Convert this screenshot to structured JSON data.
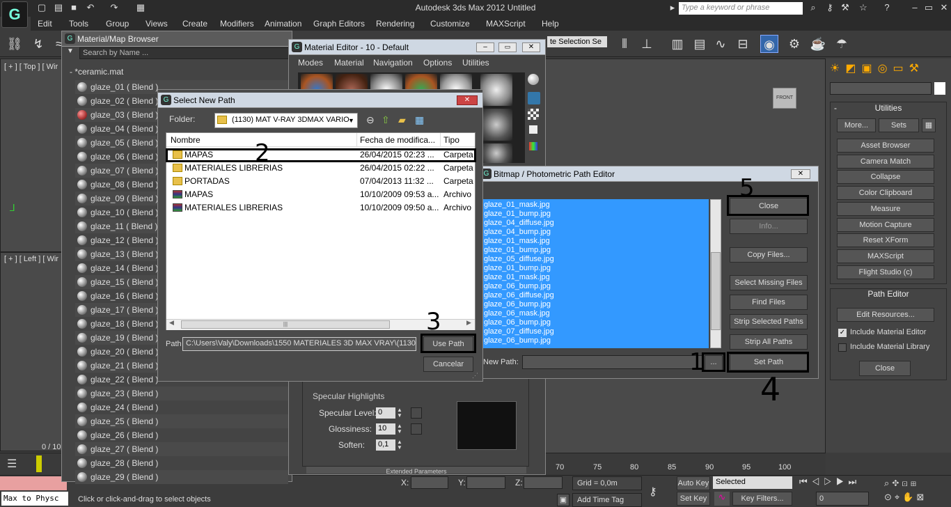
{
  "app": {
    "title": "Autodesk 3ds Max  2012     Untitled",
    "search_placeholder": "Type a keyword or phrase"
  },
  "menu": [
    "Edit",
    "Tools",
    "Group",
    "Views",
    "Create",
    "Modifiers",
    "Animation",
    "Graph Editors",
    "Rendering",
    "Customize",
    "MAXScript",
    "Help"
  ],
  "toolbar": {
    "selection_set": "te Selection Se"
  },
  "viewports": {
    "top_label": "[ + ] [ Top ] [ Wir",
    "left_label": "[ + ] [ Left ] [ Wir",
    "frame_counter": "0 / 10"
  },
  "browser": {
    "title": "Material/Map Browser",
    "search_placeholder": "Search by Name ...",
    "group": "- *ceramic.mat",
    "items": [
      "glaze_01  ( Blend )",
      "glaze_02  ( Blend )",
      "glaze_03  ( Blend )",
      "glaze_04  ( Blend )",
      "glaze_05  ( Blend )",
      "glaze_06  ( Blend )",
      "glaze_07  ( Blend )",
      "glaze_08  ( Blend )",
      "glaze_09  ( Blend )",
      "glaze_10  ( Blend )",
      "glaze_11  ( Blend )",
      "glaze_12  ( Blend )",
      "glaze_13  ( Blend )",
      "glaze_14  ( Blend )",
      "glaze_15  ( Blend )",
      "glaze_16  ( Blend )",
      "glaze_17  ( Blend )",
      "glaze_18  ( Blend )",
      "glaze_19  ( Blend )",
      "glaze_20  ( Blend )",
      "glaze_21  ( Blend )",
      "glaze_22  ( Blend )",
      "glaze_23  ( Blend )",
      "glaze_24  ( Blend )",
      "glaze_25  ( Blend )",
      "glaze_26  ( Blend )",
      "glaze_27  ( Blend )",
      "glaze_28  ( Blend )",
      "glaze_29  ( Blend )"
    ]
  },
  "mat_editor": {
    "title": "Material Editor - 10 - Default",
    "menu": [
      "Modes",
      "Material",
      "Navigation",
      "Options",
      "Utilities"
    ],
    "specular_group": "Specular Highlights",
    "specular_level_label": "Specular Level:",
    "specular_level": "0",
    "glossiness_label": "Glossiness:",
    "glossiness": "10",
    "soften_label": "Soften:",
    "soften": "0,1",
    "extended": "Extended Parameters"
  },
  "select_path": {
    "title": "Select New Path",
    "folder_label": "Folder:",
    "folder_value": "(1130) MAT  V-RAY 3DMAX VARIO",
    "columns": [
      "Nombre",
      "Fecha de modifica...",
      "Tipo"
    ],
    "rows": [
      {
        "name": "MAPAS",
        "date": "26/04/2015 02:23 ...",
        "type": "Carpeta",
        "kind": "folder"
      },
      {
        "name": "MATERIALES LIBRERIAS",
        "date": "26/04/2015 02:22 ...",
        "type": "Carpeta",
        "kind": "folder"
      },
      {
        "name": "PORTADAS",
        "date": "07/04/2013 11:32 ...",
        "type": "Carpeta",
        "kind": "folder"
      },
      {
        "name": "MAPAS",
        "date": "10/10/2009 09:53 a...",
        "type": "Archivo",
        "kind": "archive"
      },
      {
        "name": "MATERIALES LIBRERIAS",
        "date": "10/10/2009 09:50 a...",
        "type": "Archivo",
        "kind": "archive"
      }
    ],
    "path_label": "Path",
    "path_value": "C:\\Users\\Valy\\Downloads\\1550 MATERIALES 3D MAX VRAY\\(1130) M",
    "use_path": "Use Path",
    "cancel": "Cancelar"
  },
  "bitmap_editor": {
    "title": "Bitmap / Photometric Path Editor",
    "files": [
      "glaze_01_mask.jpg",
      "glaze_01_bump.jpg",
      "glaze_04_diffuse.jpg",
      "glaze_04_bump.jpg",
      "glaze_01_mask.jpg",
      "glaze_01_bump.jpg",
      "glaze_05_diffuse.jpg",
      "glaze_01_bump.jpg",
      "glaze_01_mask.jpg",
      "glaze_06_bump.jpg",
      "glaze_06_diffuse.jpg",
      "glaze_06_bump.jpg",
      "glaze_06_mask.jpg",
      "glaze_06_bump.jpg",
      "glaze_07_diffuse.jpg",
      "glaze_06_bump.jpg"
    ],
    "close": "Close",
    "info": "Info...",
    "copy_files": "Copy Files...",
    "select_missing": "Select Missing Files",
    "find_files": "Find Files",
    "strip_selected": "Strip Selected Paths",
    "strip_all": "Strip All Paths",
    "new_path_label": "New Path:",
    "browse": "...",
    "set_path": "Set Path"
  },
  "command_panel": {
    "utilities_title": "Utilities",
    "more": "More...",
    "sets": "Sets",
    "utilities": [
      "Asset Browser",
      "Camera Match",
      "Collapse",
      "Color Clipboard",
      "Measure",
      "Motion Capture",
      "Reset XForm",
      "MAXScript",
      "Flight Studio (c)"
    ],
    "path_editor_title": "Path Editor",
    "edit_resources": "Edit Resources...",
    "include_material_editor": "Include Material Editor",
    "include_material_library": "Include Material Library",
    "close": "Close",
    "viewcube": "FRONT"
  },
  "annotations": [
    "1",
    "2",
    "3",
    "4",
    "5"
  ],
  "statusbar": {
    "script_mini": "Max to Physc",
    "prompt": "Click or click-and-drag to select objects",
    "x_label": "X:",
    "y_label": "Y:",
    "z_label": "Z:",
    "grid": "Grid = 0,0m",
    "auto_key": "Auto Key",
    "selected": "Selected",
    "set_key": "Set Key",
    "key_filters": "Key Filters...",
    "add_time_tag": "Add Time Tag",
    "frame": "0",
    "ruler": [
      "70",
      "75",
      "80",
      "85",
      "90",
      "95",
      "100"
    ]
  },
  "colors": {
    "accent_blue": "#3399ff",
    "bg": "#3c3c3c"
  }
}
